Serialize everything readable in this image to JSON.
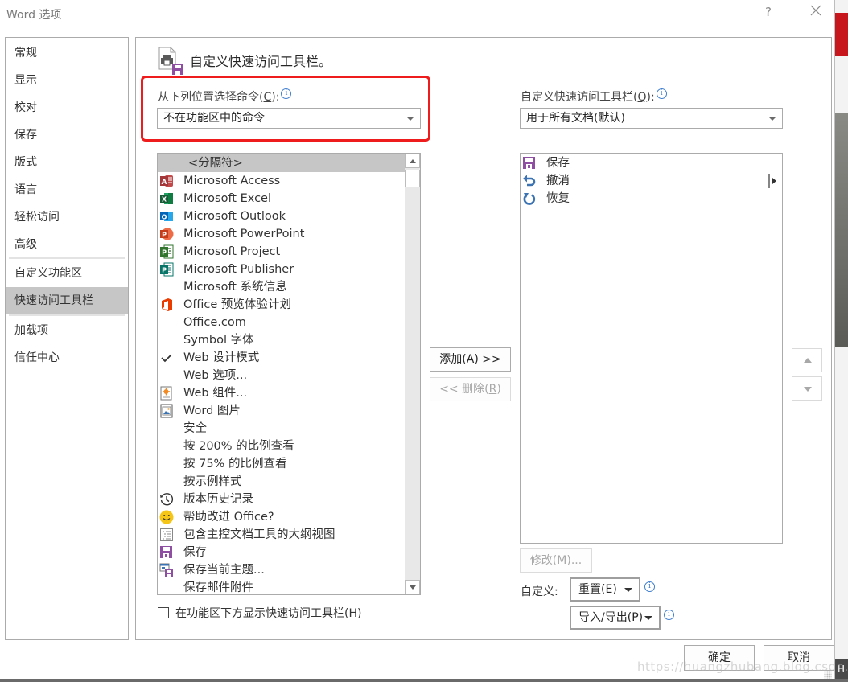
{
  "window": {
    "title": "Word 选项",
    "help_label": "?",
    "close_label": "✕"
  },
  "sidebar": {
    "items": [
      {
        "label": "常规",
        "active": false
      },
      {
        "label": "显示",
        "active": false
      },
      {
        "label": "校对",
        "active": false
      },
      {
        "label": "保存",
        "active": false
      },
      {
        "label": "版式",
        "active": false
      },
      {
        "label": "语言",
        "active": false
      },
      {
        "label": "轻松访问",
        "active": false
      },
      {
        "label": "高级",
        "active": false
      },
      {
        "label": "自定义功能区",
        "active": false
      },
      {
        "label": "快速访问工具栏",
        "active": true
      },
      {
        "label": "加载项",
        "active": false
      },
      {
        "label": "信任中心",
        "active": false
      }
    ]
  },
  "header": {
    "icon": "quick-access-toolbar-icon",
    "title": "自定义快速访问工具栏。"
  },
  "choose_commands": {
    "label": "从下列位置选择命令(",
    "accel": "C",
    "label_end": "):",
    "info_icon": "info-icon",
    "selected": "不在功能区中的命令",
    "highlight_color": "#ee1c1c"
  },
  "commands_list": {
    "items": [
      {
        "label": "<分隔符>",
        "icon": "",
        "selected": true
      },
      {
        "label": "Microsoft Access",
        "icon": "access-icon"
      },
      {
        "label": "Microsoft Excel",
        "icon": "excel-icon"
      },
      {
        "label": "Microsoft Outlook",
        "icon": "outlook-icon"
      },
      {
        "label": "Microsoft PowerPoint",
        "icon": "powerpoint-icon"
      },
      {
        "label": "Microsoft Project",
        "icon": "project-icon"
      },
      {
        "label": "Microsoft Publisher",
        "icon": "publisher-icon"
      },
      {
        "label": "Microsoft 系统信息",
        "icon": ""
      },
      {
        "label": "Office 预览体验计划",
        "icon": "office-icon"
      },
      {
        "label": "Office.com",
        "icon": ""
      },
      {
        "label": "Symbol 字体",
        "icon": ""
      },
      {
        "label": "Web 设计模式",
        "icon": "checkmark-icon"
      },
      {
        "label": "Web 选项...",
        "icon": ""
      },
      {
        "label": "Web 组件...",
        "icon": "web-component-icon"
      },
      {
        "label": "Word 图片",
        "icon": "word-picture-icon"
      },
      {
        "label": "安全",
        "icon": ""
      },
      {
        "label": "按 200% 的比例查看",
        "icon": ""
      },
      {
        "label": "按 75% 的比例查看",
        "icon": ""
      },
      {
        "label": "按示例样式",
        "icon": ""
      },
      {
        "label": "版本历史记录",
        "icon": "history-icon"
      },
      {
        "label": "帮助改进 Office?",
        "icon": "smiley-icon"
      },
      {
        "label": "包含主控文档工具的大纲视图",
        "icon": "outline-view-icon"
      },
      {
        "label": "保存",
        "icon": "save-icon"
      },
      {
        "label": "保存当前主题...",
        "icon": "save-theme-icon"
      },
      {
        "label": "保存邮件附件",
        "icon": ""
      }
    ]
  },
  "show_below_ribbon": {
    "label": "在功能区下方显示快速访问工具栏(",
    "accel": "H",
    "label_end": ")",
    "checked": false
  },
  "add_button": {
    "label": "添加(",
    "accel": "A",
    "label_end": ") >>"
  },
  "remove_button": {
    "label": "<< 删除(",
    "accel": "R",
    "label_end": ")",
    "disabled": true
  },
  "customize_toolbar": {
    "label": "自定义快速访问工具栏(",
    "accel": "Q",
    "label_end": "):",
    "info_icon": "info-icon",
    "selected": "用于所有文档(默认)"
  },
  "toolbar_list": {
    "items": [
      {
        "label": "保存",
        "icon": "save-icon"
      },
      {
        "label": "撤消",
        "icon": "undo-icon"
      },
      {
        "label": "恢复",
        "icon": "redo-icon"
      }
    ],
    "expand_icon": "separator-expand-icon"
  },
  "move_up_icon": "move-up-icon",
  "move_down_icon": "move-down-icon",
  "modify_button": {
    "label": "修改(",
    "accel": "M",
    "label_end": ")...",
    "disabled": true
  },
  "customizations": {
    "label": "自定义:",
    "reset": {
      "label": "重置(",
      "accel": "E",
      "label_end": ")"
    },
    "import_export": {
      "label": "导入/导出(",
      "accel": "P",
      "label_end": ")"
    }
  },
  "footer": {
    "ok_label": "确定",
    "cancel_label": "取消"
  },
  "watermark": "https://huangzhubang.blog.csdn.net",
  "edge_peek_label": "H"
}
